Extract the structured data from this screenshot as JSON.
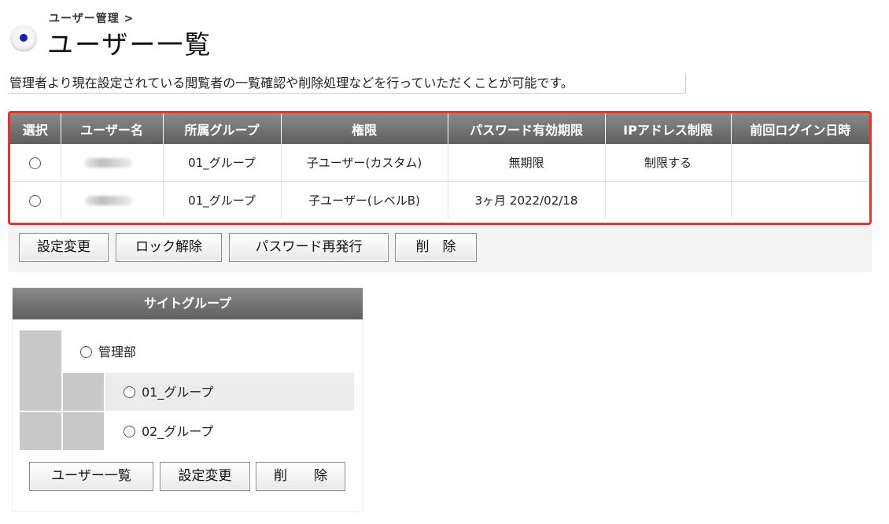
{
  "header": {
    "breadcrumb": "ユーザー管理 >",
    "title": "ユーザー一覧",
    "description": "管理者より現在設定されている閲覧者の一覧確認や削除処理などを行っていただくことが可能です。"
  },
  "user_table": {
    "columns": [
      "選択",
      "ユーザー名",
      "所属グループ",
      "権限",
      "パスワード有効期限",
      "IPアドレス制限",
      "前回ログイン日時"
    ],
    "rows": [
      {
        "group": "01_グループ",
        "permission": "子ユーザー(カスタム)",
        "password_expiry": "無期限",
        "ip_restriction": "制限する",
        "last_login": ""
      },
      {
        "group": "01_グループ",
        "permission": "子ユーザー(レベルB)",
        "password_expiry": "3ヶ月 2022/02/18",
        "ip_restriction": "",
        "last_login": ""
      }
    ]
  },
  "user_actions": {
    "change_settings": "設定変更",
    "unlock": "ロック解除",
    "reissue_password": "パスワード再発行",
    "delete": "削　除"
  },
  "site_group": {
    "title": "サイトグループ",
    "items": [
      {
        "label": "管理部"
      },
      {
        "label": "01_グループ"
      },
      {
        "label": "02_グループ"
      }
    ],
    "actions": {
      "user_list": "ユーザー一覧",
      "change_settings": "設定変更",
      "delete": "削　　除"
    }
  },
  "colors": {
    "highlight_border": "#e8352c",
    "header_bg": "#6e6e6e"
  }
}
